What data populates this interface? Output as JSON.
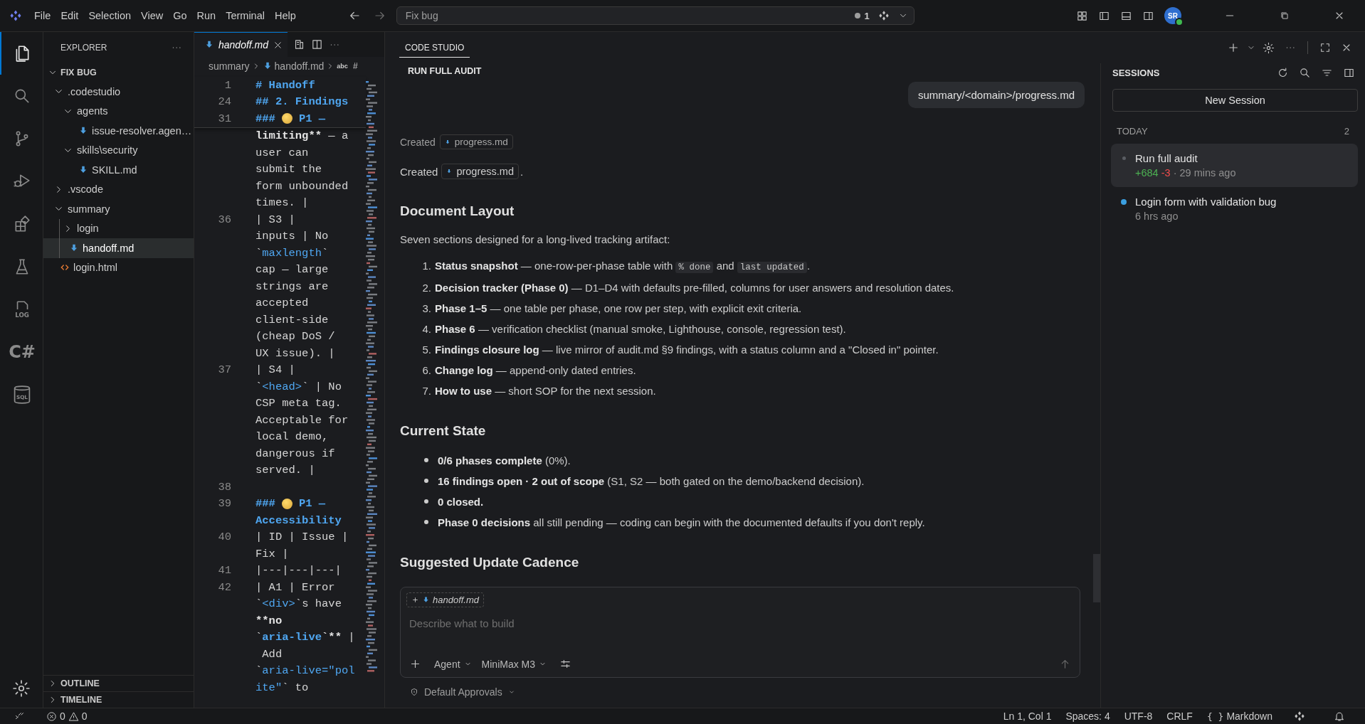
{
  "menu_bar": {
    "items": [
      "File",
      "Edit",
      "Selection",
      "View",
      "Go",
      "Run",
      "Terminal",
      "Help"
    ]
  },
  "command_center": {
    "value": "Fix bug",
    "badge": "1"
  },
  "account": {
    "initials": "SR",
    "online": true
  },
  "activity_bar": {
    "items": [
      {
        "kind": "files",
        "selected": true
      },
      {
        "kind": "search",
        "selected": false
      },
      {
        "kind": "source-control",
        "selected": false
      },
      {
        "kind": "run",
        "selected": false
      },
      {
        "kind": "extensions",
        "selected": false
      },
      {
        "kind": "testing",
        "selected": false
      },
      {
        "kind": "log",
        "label": "LOG",
        "selected": false
      },
      {
        "kind": "text",
        "label": "C#",
        "selected": false
      },
      {
        "kind": "database",
        "label": "SQL",
        "selected": false
      }
    ]
  },
  "explorer": {
    "title": "EXPLORER",
    "folder": {
      "name": "FIX BUG",
      "expanded": true
    },
    "tree": [
      {
        "name": ".codestudio",
        "kind": "folder",
        "expanded": true,
        "selected": false,
        "children": [
          {
            "name": "agents",
            "kind": "folder",
            "expanded": true,
            "selected": false,
            "children": [
              {
                "name": "issue-resolver.agen…",
                "kind": "markdown",
                "selected": false
              }
            ]
          },
          {
            "name": "skills\\security",
            "kind": "folder",
            "expanded": true,
            "selected": false,
            "children": [
              {
                "name": "SKILL.md",
                "kind": "markdown",
                "selected": false
              }
            ]
          }
        ]
      },
      {
        "name": ".vscode",
        "kind": "folder",
        "expanded": false,
        "selected": false
      },
      {
        "name": "summary",
        "kind": "folder",
        "expanded": true,
        "selected": false,
        "children": [
          {
            "name": "login",
            "kind": "folder",
            "expanded": false,
            "selected": false
          },
          {
            "name": "handoff.md",
            "kind": "markdown",
            "selected": true
          }
        ]
      },
      {
        "name": "login.html",
        "kind": "html",
        "selected": false
      }
    ],
    "sections": [
      {
        "name": "OUTLINE",
        "expanded": false
      },
      {
        "name": "TIMELINE",
        "expanded": false
      }
    ]
  },
  "editor": {
    "tab": {
      "name": "handoff.md",
      "preview": true
    },
    "breadcrumbs": [
      "summary",
      "handoff.md"
    ],
    "breadcrumb_symbols": [
      "abc",
      "#"
    ],
    "sticky_rows": [
      {
        "number": "1",
        "segments": [
          {
            "kind": "heading",
            "text": "# Handoff"
          }
        ]
      },
      {
        "number": "24",
        "segments": [
          {
            "kind": "heading",
            "text": "## 2. Findings"
          }
        ]
      },
      {
        "number": "31",
        "segments": [
          {
            "kind": "heading",
            "text": "###"
          },
          {
            "kind": "emoji"
          },
          {
            "kind": "heading",
            "text": "P1 —"
          }
        ]
      }
    ],
    "rows": [
      {
        "segments": [
          {
            "kind": "bold",
            "text": "limiting**"
          },
          {
            "kind": "text",
            "text": " — a"
          }
        ]
      },
      {
        "segments": [
          {
            "kind": "text",
            "text": "user can"
          }
        ]
      },
      {
        "segments": [
          {
            "kind": "text",
            "text": "submit the"
          }
        ]
      },
      {
        "segments": [
          {
            "kind": "text",
            "text": "form unbounded"
          }
        ]
      },
      {
        "segments": [
          {
            "kind": "text",
            "text": "times. |"
          }
        ]
      },
      {
        "number": "36",
        "segments": [
          {
            "kind": "text",
            "text": "| S3 |"
          }
        ]
      },
      {
        "segments": [
          {
            "kind": "text",
            "text": "inputs | No"
          }
        ]
      },
      {
        "segments": [
          {
            "kind": "text",
            "text": "`"
          },
          {
            "kind": "code",
            "text": "maxlength"
          },
          {
            "kind": "text",
            "text": "`"
          }
        ]
      },
      {
        "segments": [
          {
            "kind": "text",
            "text": "cap — large"
          }
        ]
      },
      {
        "segments": [
          {
            "kind": "text",
            "text": "strings are"
          }
        ]
      },
      {
        "segments": [
          {
            "kind": "text",
            "text": "accepted"
          }
        ]
      },
      {
        "segments": [
          {
            "kind": "text",
            "text": "client-side"
          }
        ]
      },
      {
        "segments": [
          {
            "kind": "text",
            "text": "(cheap DoS /"
          }
        ]
      },
      {
        "segments": [
          {
            "kind": "text",
            "text": "UX issue). |"
          }
        ]
      },
      {
        "number": "37",
        "segments": [
          {
            "kind": "text",
            "text": "| S4 |"
          }
        ]
      },
      {
        "segments": [
          {
            "kind": "text",
            "text": "`"
          },
          {
            "kind": "code",
            "text": "<head>"
          },
          {
            "kind": "text",
            "text": "` | No"
          }
        ]
      },
      {
        "segments": [
          {
            "kind": "text",
            "text": "CSP meta tag."
          }
        ]
      },
      {
        "segments": [
          {
            "kind": "text",
            "text": "Acceptable for"
          }
        ]
      },
      {
        "segments": [
          {
            "kind": "text",
            "text": "local demo,"
          }
        ]
      },
      {
        "segments": [
          {
            "kind": "text",
            "text": "dangerous if"
          }
        ]
      },
      {
        "segments": [
          {
            "kind": "text",
            "text": "served. |"
          }
        ]
      },
      {
        "number": "38",
        "segments": []
      },
      {
        "number": "39",
        "segments": [
          {
            "kind": "heading",
            "text": "###"
          },
          {
            "kind": "emoji"
          },
          {
            "kind": "heading",
            "text": "P1 —"
          }
        ]
      },
      {
        "segments": [
          {
            "kind": "heading",
            "text": "Accessibility"
          }
        ]
      },
      {
        "number": "40",
        "segments": [
          {
            "kind": "text",
            "text": "| ID | Issue |"
          }
        ]
      },
      {
        "segments": [
          {
            "kind": "text",
            "text": "Fix |"
          }
        ]
      },
      {
        "number": "41",
        "segments": [
          {
            "kind": "text",
            "text": "|---|---|---|"
          }
        ]
      },
      {
        "number": "42",
        "segments": [
          {
            "kind": "text",
            "text": "| A1 | Error"
          }
        ]
      },
      {
        "segments": [
          {
            "kind": "text",
            "text": "`"
          },
          {
            "kind": "code",
            "text": "<div>"
          },
          {
            "kind": "text",
            "text": "`s have"
          }
        ]
      },
      {
        "segments": [
          {
            "kind": "bold",
            "text": "**no"
          }
        ]
      },
      {
        "segments": [
          {
            "kind": "text",
            "text": "`"
          },
          {
            "kind": "codebold",
            "text": "aria-live"
          },
          {
            "kind": "bold",
            "text": "`**"
          },
          {
            "kind": "text",
            "text": " |"
          }
        ]
      },
      {
        "segments": [
          {
            "kind": "text",
            "text": " Add"
          }
        ]
      },
      {
        "segments": [
          {
            "kind": "text",
            "text": "`"
          },
          {
            "kind": "code",
            "text": "aria-live=\"pol"
          }
        ]
      },
      {
        "segments": [
          {
            "kind": "code",
            "text": "ite\""
          },
          {
            "kind": "text",
            "text": "` to"
          }
        ]
      }
    ]
  },
  "chat": {
    "tab": "CODE STUDIO",
    "title": "RUN FULL AUDIT",
    "user_message": "summary/<domain>/progress.md",
    "tool_note": {
      "label": "Created",
      "file": "progress.md"
    },
    "reply_intro": {
      "label": "Created",
      "file": "progress.md",
      "suffix": "."
    },
    "sections": [
      {
        "heading": "Document Layout",
        "paragraph": "Seven sections designed for a long-lived tracking artifact:",
        "items": [
          {
            "number": "1.",
            "segments": [
              {
                "kind": "bold",
                "text": "Status snapshot"
              },
              {
                "kind": "text",
                "text": " — one-row-per-phase table with "
              },
              {
                "kind": "code",
                "text": "% done"
              },
              {
                "kind": "text",
                "text": " and "
              },
              {
                "kind": "code",
                "text": "last updated"
              },
              {
                "kind": "text",
                "text": "."
              }
            ]
          },
          {
            "number": "2.",
            "segments": [
              {
                "kind": "bold",
                "text": "Decision tracker (Phase 0)"
              },
              {
                "kind": "text",
                "text": " — D1–D4 with defaults pre-filled, columns for user answers and resolution dates."
              }
            ]
          },
          {
            "number": "3.",
            "segments": [
              {
                "kind": "bold",
                "text": "Phase 1–5"
              },
              {
                "kind": "text",
                "text": " — one table per phase, one row per step, with explicit exit criteria."
              }
            ]
          },
          {
            "number": "4.",
            "segments": [
              {
                "kind": "bold",
                "text": "Phase 6"
              },
              {
                "kind": "text",
                "text": " — verification checklist (manual smoke, Lighthouse, console, regression test)."
              }
            ]
          },
          {
            "number": "5.",
            "segments": [
              {
                "kind": "bold",
                "text": "Findings closure log"
              },
              {
                "kind": "text",
                "text": " — live mirror of audit.md §9 findings, with a status column and a \"Closed in\" pointer."
              }
            ]
          },
          {
            "number": "6.",
            "segments": [
              {
                "kind": "bold",
                "text": "Change log"
              },
              {
                "kind": "text",
                "text": " — append-only dated entries."
              }
            ]
          },
          {
            "number": "7.",
            "segments": [
              {
                "kind": "bold",
                "text": "How to use"
              },
              {
                "kind": "text",
                "text": " — short SOP for the next session."
              }
            ]
          }
        ]
      },
      {
        "heading": "Current State",
        "items": [
          {
            "segments": [
              {
                "kind": "bold",
                "text": "0/6 phases complete"
              },
              {
                "kind": "text",
                "text": " (0%)."
              }
            ]
          },
          {
            "segments": [
              {
                "kind": "bold",
                "text": "16 findings open · 2 out of scope"
              },
              {
                "kind": "text",
                "text": " (S1, S2 — both gated on the demo/backend decision)."
              }
            ]
          },
          {
            "segments": [
              {
                "kind": "bold",
                "text": "0 closed."
              }
            ]
          },
          {
            "segments": [
              {
                "kind": "bold",
                "text": "Phase 0 decisions"
              },
              {
                "kind": "text",
                "text": " all still pending — coding can begin with the documented defaults if you don't reply."
              }
            ]
          }
        ]
      },
      {
        "heading": "Suggested Update Cadence"
      }
    ],
    "composer": {
      "attachment": "handoff.md",
      "placeholder": "Describe what to build",
      "mode": "Agent",
      "model": "MiniMax M3",
      "approvals": "Default Approvals"
    }
  },
  "sessions": {
    "title": "SESSIONS",
    "new_button": "New Session",
    "group": {
      "label": "TODAY",
      "count": "2"
    },
    "items": [
      {
        "title": "Run full audit",
        "added": "+684",
        "removed": "-3",
        "separator": "·",
        "time": "29 mins ago",
        "selected": true,
        "color": "#5a5d63"
      },
      {
        "title": "Login form with validation bug",
        "time": "6 hrs ago",
        "selected": false,
        "color": "#3b9fe0"
      }
    ]
  },
  "status_bar": {
    "errors": "0",
    "warnings": "0",
    "items": [
      "Ln 1, Col 1",
      "Spaces: 4",
      "UTF-8",
      "CRLF"
    ],
    "language_icon": "{ }",
    "language": "Markdown"
  }
}
